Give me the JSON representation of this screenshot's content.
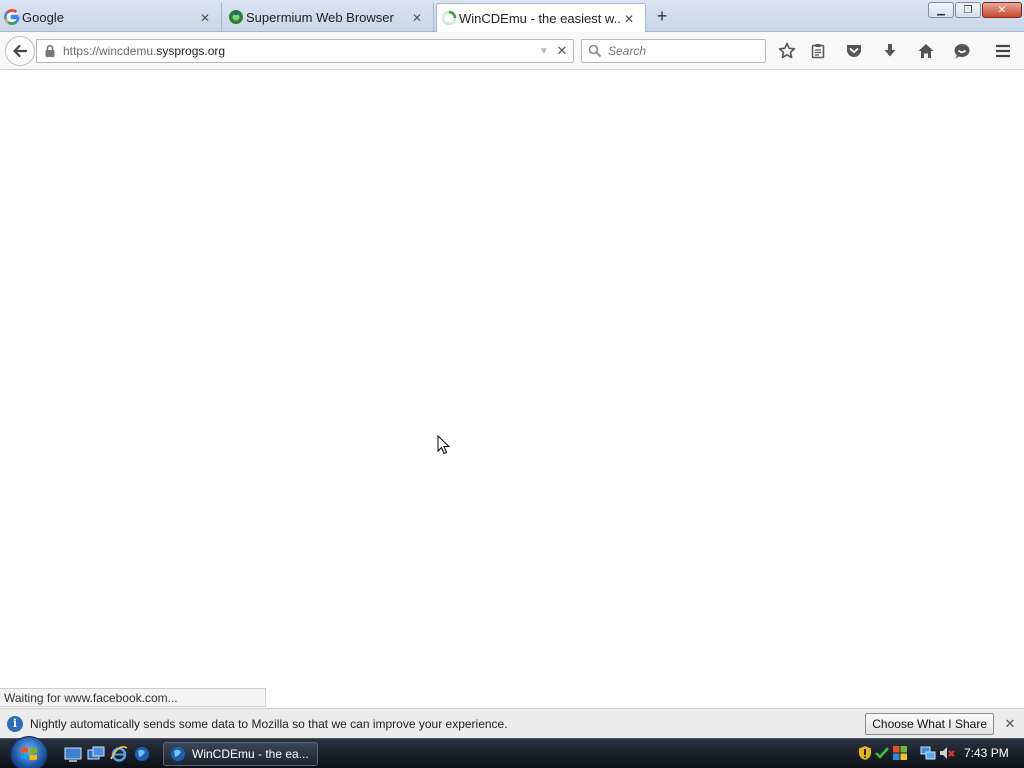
{
  "tabs": [
    {
      "title": "Google",
      "favicon": "google-g-icon",
      "active": false
    },
    {
      "title": "Supermium Web Browser",
      "favicon": "supermium-icon",
      "active": false
    },
    {
      "title": "WinCDEmu - the easiest w...",
      "favicon": "loading-spinner-icon",
      "active": true
    }
  ],
  "url": {
    "prefix": "https://wincdemu.",
    "domain": "sysprogs.org"
  },
  "search": {
    "placeholder": "Search"
  },
  "status": {
    "text": "Waiting for www.facebook.com..."
  },
  "notification": {
    "message": "Nightly automatically sends some data to Mozilla so that we can improve your experience.",
    "button": "Choose What I Share"
  },
  "taskbar": {
    "task_label": "WinCDEmu - the ea...",
    "clock": "7:43 PM"
  },
  "colors": {
    "accent": "#2d6cc0",
    "taskbar": "#0c1016"
  }
}
